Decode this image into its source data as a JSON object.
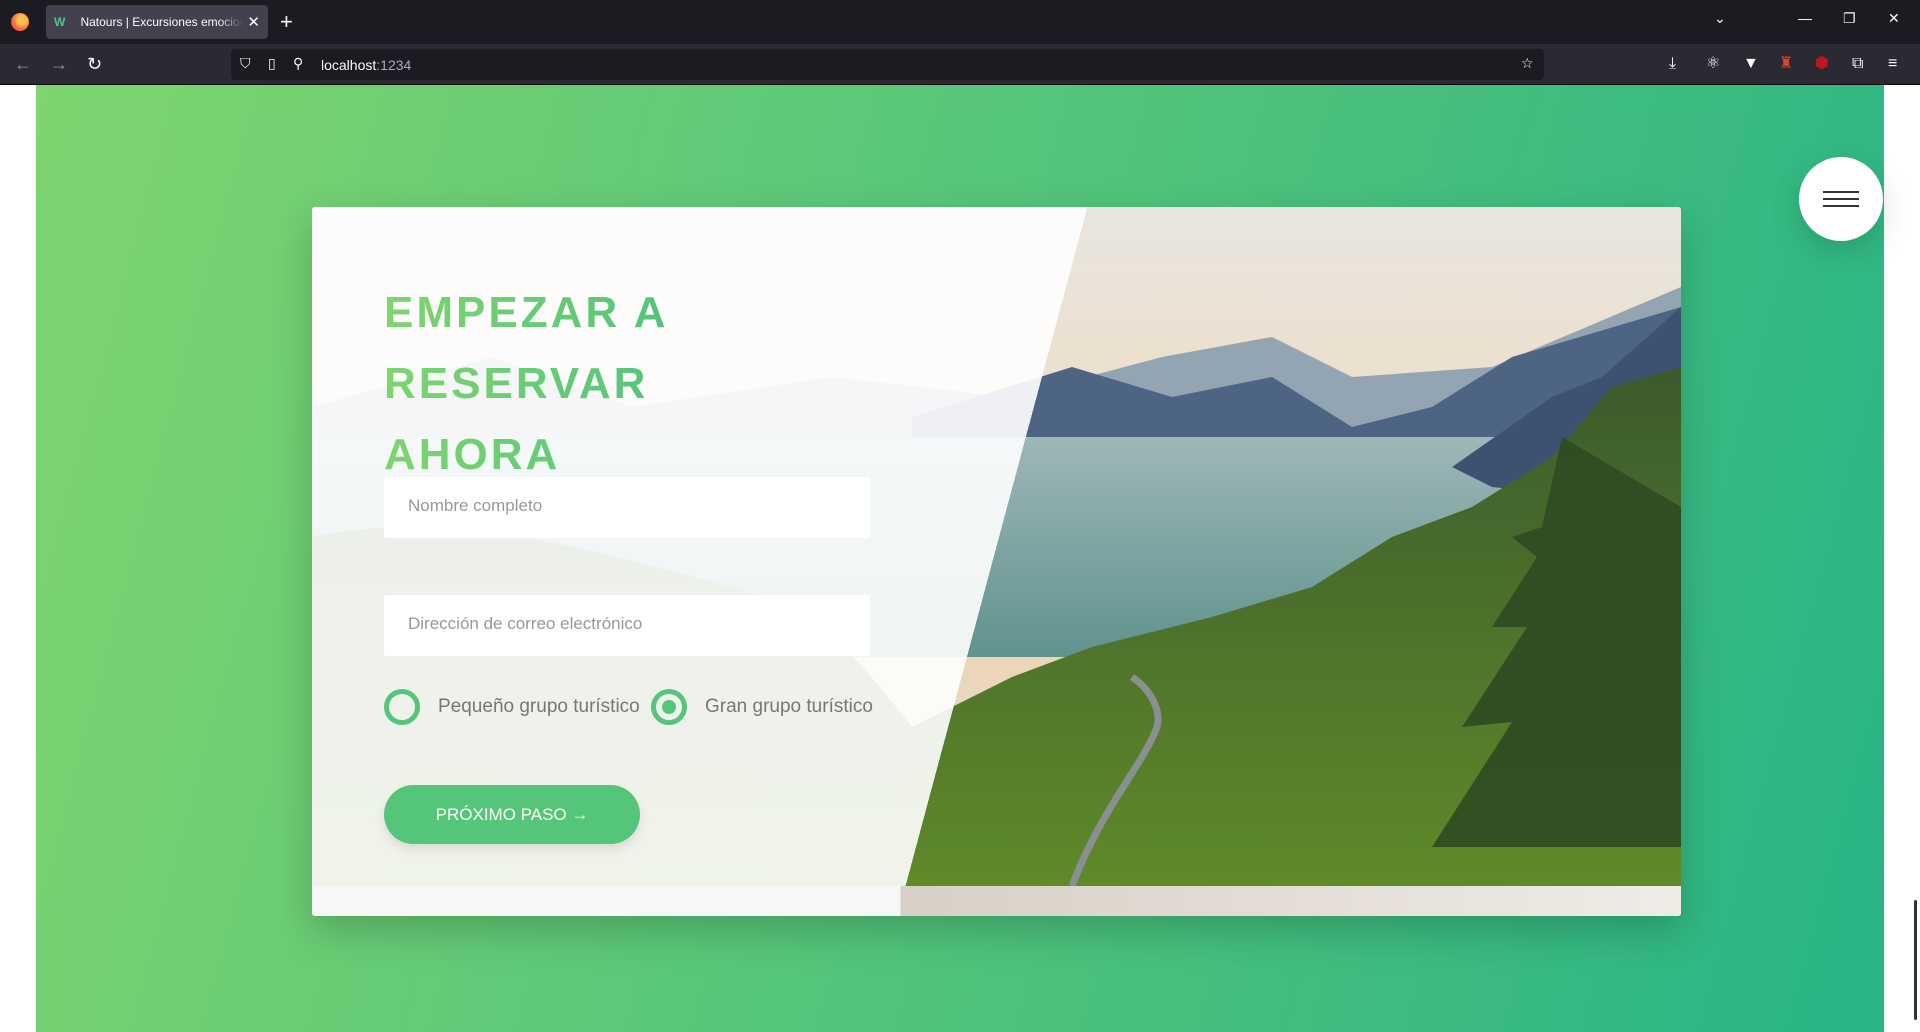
{
  "browser": {
    "tab_title": "Natours | Excursiones emocionantes",
    "tab_favicon": "natours-logo-icon",
    "url_host": "localhost",
    "url_port": ":1234"
  },
  "page": {
    "heading_line1": "Empezar a reservar",
    "heading_line2": "ahora",
    "name_placeholder": "Nombre completo",
    "email_placeholder": "Dirección de correo electrónico",
    "radio_small_label": "Pequeño grupo turístico",
    "radio_large_label": "Gran grupo turístico",
    "radio_selected": "large",
    "submit_label": "Próximo paso →"
  },
  "colors": {
    "primary": "#55c57a",
    "gradient_light": "#7ed56f",
    "gradient_dark": "#28b485"
  }
}
